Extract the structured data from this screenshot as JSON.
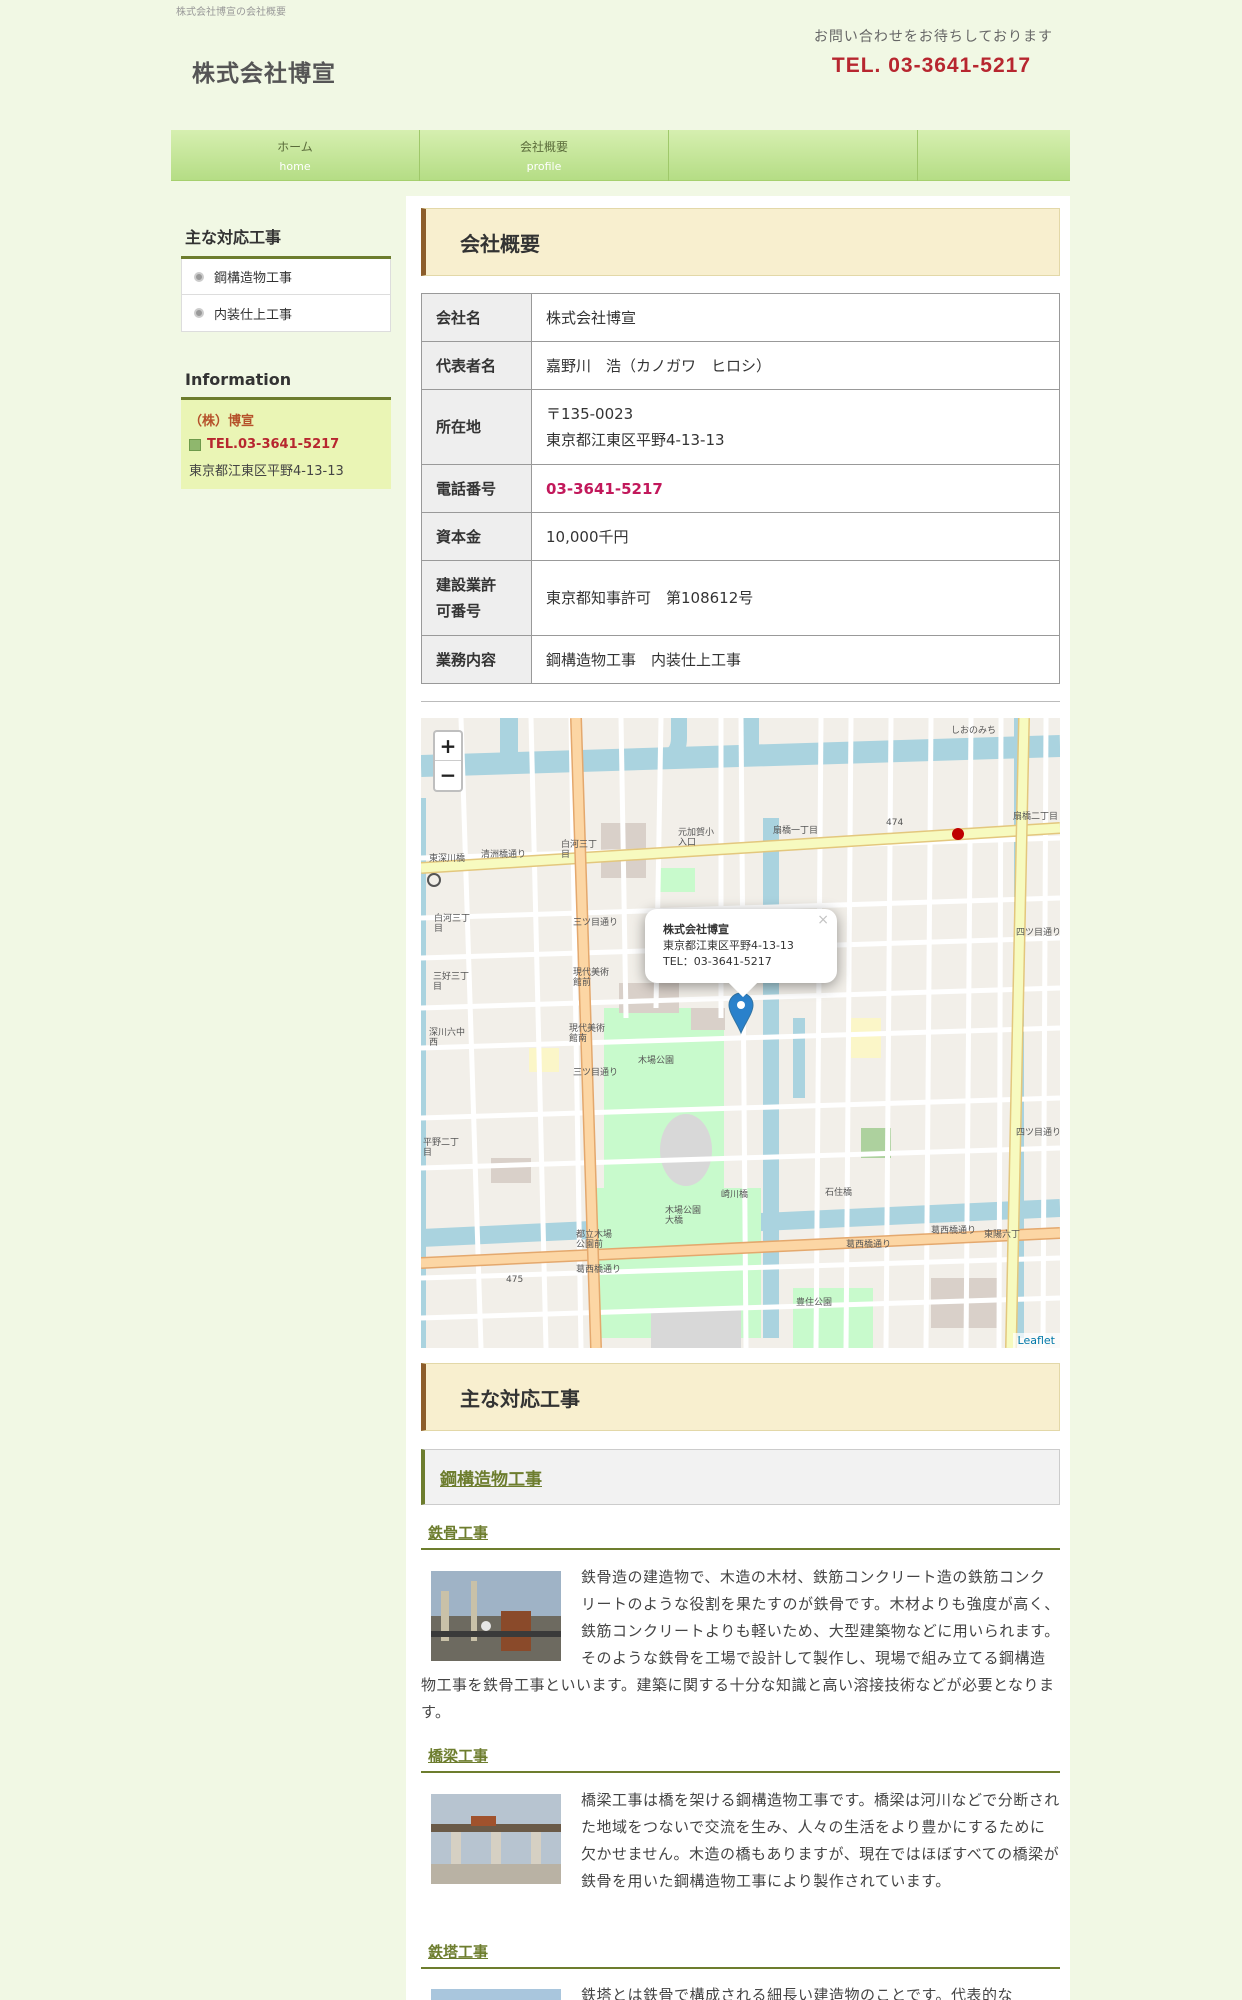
{
  "header": {
    "caption": "株式会社博宣の会社概要",
    "site_title": "株式会社博宣",
    "contact_message": "お問い合わせをお待ちしております",
    "tel": "TEL. 03-3641-5217"
  },
  "nav": [
    {
      "label": "ホーム",
      "sub": "home"
    },
    {
      "label": "会社概要",
      "sub": "profile"
    }
  ],
  "sidebar": {
    "services_heading": "主な対応工事",
    "services": [
      "鋼構造物工事",
      "内装仕上工事"
    ],
    "info_heading": "Information",
    "info": {
      "company": "（株）博宣",
      "tel": "TEL.03-3641-5217",
      "address": "東京都江東区平野4-13-13"
    }
  },
  "main": {
    "profile_heading": "会社概要",
    "table": [
      {
        "label": "会社名",
        "value": "株式会社博宣"
      },
      {
        "label": "代表者名",
        "value": "嘉野川　浩（カノガワ　ヒロシ）"
      },
      {
        "label": "所在地",
        "value": "〒135-0023\n東京都江東区平野4-13-13"
      },
      {
        "label": "電話番号",
        "value": "03-3641-5217"
      },
      {
        "label": "資本金",
        "value": "10,000千円"
      },
      {
        "label": "建設業許\n可番号",
        "value": "東京都知事許可　第108612号"
      },
      {
        "label": "業務内容",
        "value": "鋼構造物工事　内装仕上工事"
      }
    ],
    "map": {
      "popup": {
        "name": "株式会社博宣",
        "address": "東京都江東区平野4-13-13",
        "tel": "TEL：03-3641-5217"
      },
      "zoom_in": "+",
      "zoom_out": "−",
      "close": "×",
      "attribution": "Leaflet",
      "labels": [
        "しおのみち",
        "扇橋二丁目",
        "474",
        "元加賀小\n入口",
        "扇橋一丁目",
        "白河三丁\n目",
        "東深川橋",
        "清洲橋通り",
        "白河三丁\n目",
        "三好三丁\n目",
        "現代美術\n館前",
        "深川六中\n西",
        "現代美術\n館南",
        "木場公園",
        "平野二丁\n目",
        "崎川橋",
        "石住橋",
        "木場公園\n大橋",
        "都立木場\n公園前",
        "葛西橋通り",
        "葛西橋通り",
        "475",
        "東陽六丁",
        "葛西橋通り",
        "三ツ目通り",
        "三ツ目通り",
        "四ツ目通り",
        "四ツ目通り",
        "豊住公園"
      ]
    },
    "works_heading": "主な対応工事",
    "works_category": "鋼構造物工事",
    "works": [
      {
        "title": "鉄骨工事",
        "text": "鉄骨造の建造物で、木造の木材、鉄筋コンクリート造の鉄筋コンクリートのような役割を果たすのが鉄骨です。木材よりも強度が高く、鉄筋コンクリートよりも軽いため、大型建築物などに用いられます。そのような鉄骨を工場で設計して製作し、現場で組み立てる鋼構造物工事を鉄骨工事といいます。建築に関する十分な知識と高い溶接技術などが必要となります。"
      },
      {
        "title": "橋梁工事",
        "text": "橋梁工事は橋を架ける鋼構造物工事です。橋梁は河川などで分断された地域をつないで交流を生み、人々の生活をより豊かにするために欠かせません。木造の橋もありますが、現在ではほぼすべての橋梁が鉄骨を用いた鋼構造物工事により製作されています。"
      },
      {
        "title": "鉄塔工事",
        "text": "鉄塔とは鉄骨で構成される細長い建造物のことです。代表的な"
      }
    ]
  }
}
